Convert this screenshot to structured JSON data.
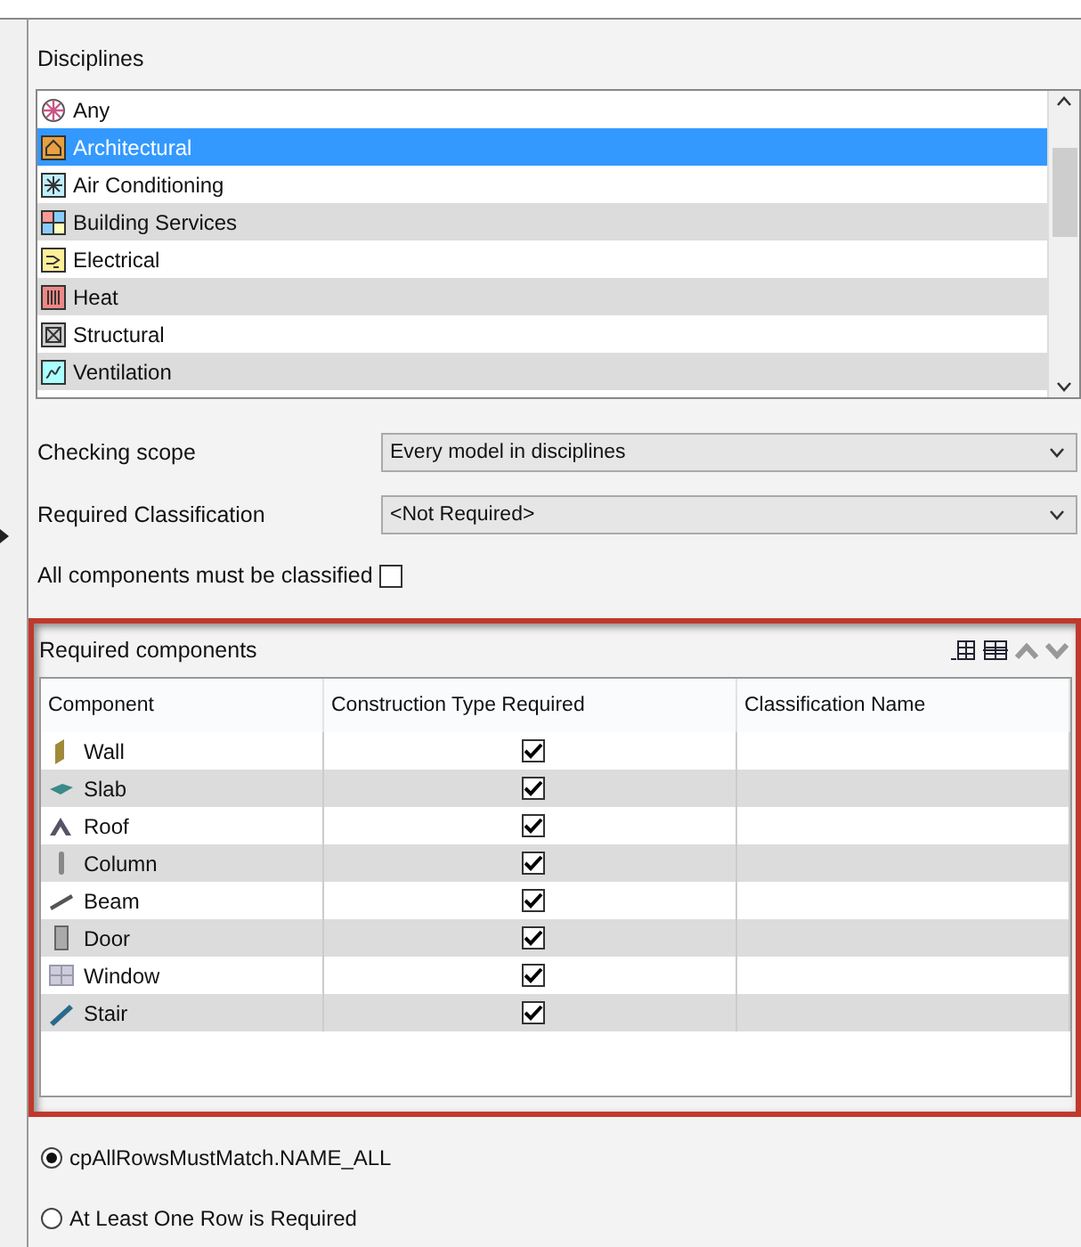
{
  "disciplines": {
    "label": "Disciplines",
    "items": [
      {
        "label": "Any",
        "selected": false
      },
      {
        "label": "Architectural",
        "selected": true
      },
      {
        "label": "Air Conditioning",
        "selected": false
      },
      {
        "label": "Building Services",
        "selected": false
      },
      {
        "label": "Electrical",
        "selected": false
      },
      {
        "label": "Heat",
        "selected": false
      },
      {
        "label": "Structural",
        "selected": false
      },
      {
        "label": "Ventilation",
        "selected": false
      }
    ]
  },
  "checking_scope": {
    "label": "Checking scope",
    "value": "Every model in disciplines"
  },
  "required_classification": {
    "label": "Required Classification",
    "value": "<Not Required>"
  },
  "all_classified": {
    "label": "All components must be classified",
    "checked": false
  },
  "required_components": {
    "title": "Required components",
    "columns": [
      "Component",
      "Construction Type Required",
      "Classification Name"
    ],
    "rows": [
      {
        "component": "Wall",
        "required": true
      },
      {
        "component": "Slab",
        "required": true
      },
      {
        "component": "Roof",
        "required": true
      },
      {
        "component": "Column",
        "required": true
      },
      {
        "component": "Beam",
        "required": true
      },
      {
        "component": "Door",
        "required": true
      },
      {
        "component": "Window",
        "required": true
      },
      {
        "component": "Stair",
        "required": true
      }
    ]
  },
  "match_options": [
    {
      "label": "cpAllRowsMustMatch.NAME_ALL",
      "selected": true
    },
    {
      "label": "At Least One Row is Required",
      "selected": false
    }
  ]
}
